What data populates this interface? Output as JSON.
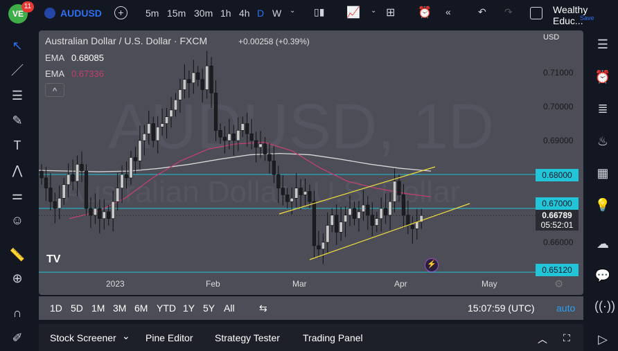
{
  "topbar": {
    "notifications": "11",
    "symbol": "AUDUSD",
    "intervals": [
      "5m",
      "15m",
      "30m",
      "1h",
      "4h",
      "D",
      "W"
    ],
    "active_interval": "D",
    "account": "Wealthy Educ...",
    "save": "Save"
  },
  "legend": {
    "title": "Australian Dollar / U.S. Dollar · FXCM",
    "change": "+0.00258 (+0.39%)",
    "ema1_label": "EMA",
    "ema1_value": "0.68085",
    "ema2_label": "EMA",
    "ema2_value": "0.67336",
    "collapse": "^"
  },
  "watermark": {
    "line1": "AUDUSD, 1D",
    "line2": "Australian Dollar / U.S. Dollar"
  },
  "price_axis": {
    "currency": "USD",
    "ticks": [
      "0.71000",
      "0.70000",
      "0.69000",
      "0.66000"
    ],
    "levels": [
      "0.68000",
      "0.67000",
      "0.65120"
    ],
    "last_price": "0.66789",
    "countdown": "05:52:01"
  },
  "time_axis": [
    "2023",
    "Feb",
    "Mar",
    "Apr",
    "May"
  ],
  "colors": {
    "ema_slow": "#d8d8d8",
    "ema_fast": "#c2416e",
    "level": "#22c4d8",
    "channel": "#f0e040",
    "up": "#c8c8c8",
    "down": "#1c1d22"
  },
  "chart_data": {
    "type": "candlestick",
    "closes": [
      0.679,
      0.676,
      0.672,
      0.67,
      0.673,
      0.677,
      0.68,
      0.678,
      0.683,
      0.681,
      0.67,
      0.668,
      0.67,
      0.667,
      0.669,
      0.667,
      0.672,
      0.676,
      0.68,
      0.679,
      0.685,
      0.684,
      0.69,
      0.692,
      0.695,
      0.69,
      0.694,
      0.695,
      0.697,
      0.699,
      0.702,
      0.705,
      0.708,
      0.707,
      0.71,
      0.708,
      0.705,
      0.712,
      0.704,
      0.693,
      0.691,
      0.69,
      0.692,
      0.69,
      0.693,
      0.695,
      0.692,
      0.69,
      0.688,
      0.689,
      0.686,
      0.684,
      0.68,
      0.676,
      0.674,
      0.672,
      0.673,
      0.676,
      0.674,
      0.675,
      0.672,
      0.659,
      0.658,
      0.66,
      0.665,
      0.668,
      0.663,
      0.666,
      0.668,
      0.67,
      0.667,
      0.669,
      0.671,
      0.668,
      0.665,
      0.667,
      0.67,
      0.668,
      0.672,
      0.678,
      0.674,
      0.668,
      0.665,
      0.664,
      0.666,
      0.66789
    ],
    "ema_slow": [
      0.6812,
      0.681,
      0.6808,
      0.681,
      0.6818,
      0.683,
      0.6845,
      0.6858,
      0.6862,
      0.6858,
      0.6845,
      0.683,
      0.6818,
      0.681
    ],
    "ema_fast": [
      0.667,
      0.669,
      0.673,
      0.679,
      0.684,
      0.6875,
      0.689,
      0.6895,
      0.687,
      0.682,
      0.678,
      0.676,
      0.6745,
      0.6734
    ],
    "ylim": [
      0.648,
      0.718
    ]
  },
  "range": {
    "buttons": [
      "1D",
      "5D",
      "1M",
      "3M",
      "6M",
      "YTD",
      "1Y",
      "5Y",
      "All"
    ],
    "clock": "15:07:59 (UTC)",
    "auto": "auto"
  },
  "bottom": {
    "tabs": [
      "Stock Screener",
      "Pine Editor",
      "Strategy Tester",
      "Trading Panel"
    ]
  }
}
